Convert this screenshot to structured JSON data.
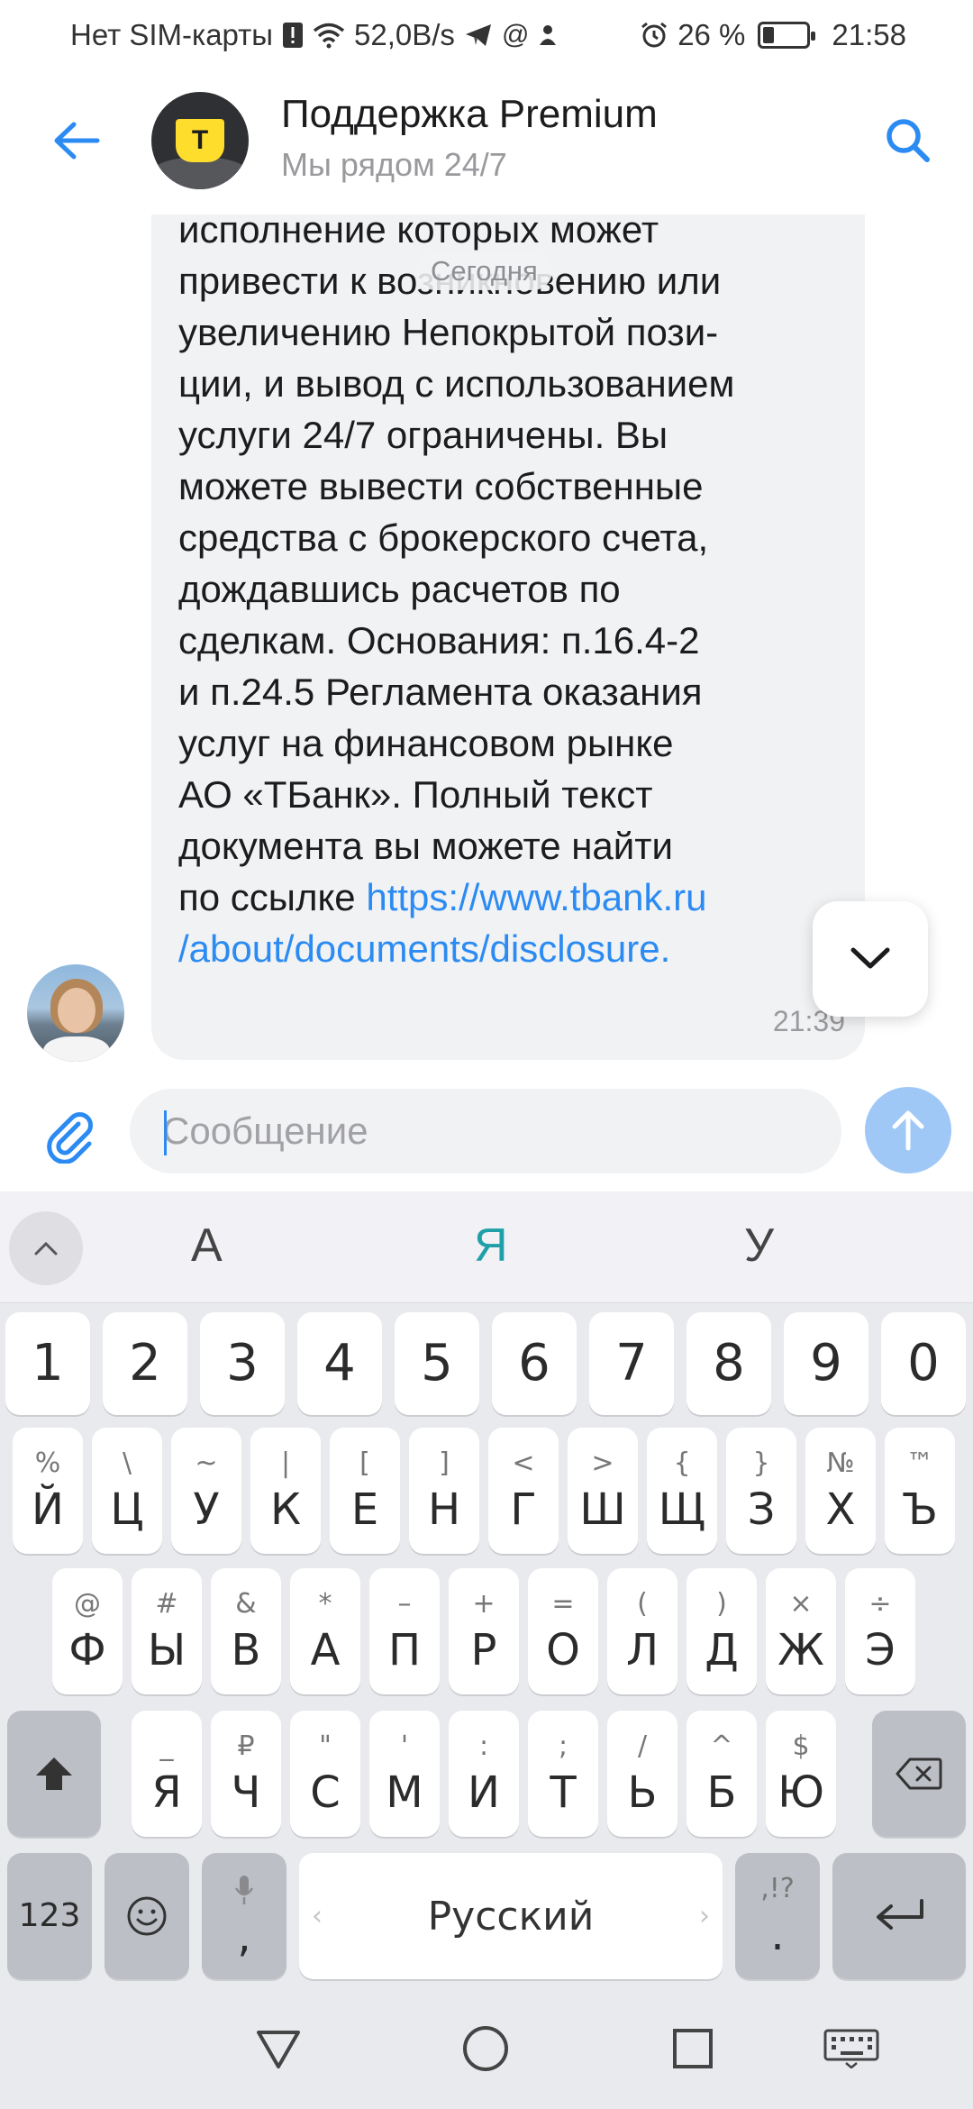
{
  "status_bar": {
    "carrier": "Нет SIM-карты",
    "net_speed": "52,0B/s",
    "battery_percent": "26 %",
    "battery_level": 0.26,
    "time": "21:58"
  },
  "header": {
    "title": "Поддержка Premium",
    "subtitle": "Мы рядом 24/7",
    "avatar_letter": "T"
  },
  "chat": {
    "date_chip": "Сегодня",
    "message": {
      "lines": [
        "исполнение которых может",
        "привести к возникновению или",
        "увеличению Непокрытой пози-",
        "ции, и вывод с использованием",
        "услуги 24/7 ограничены. Вы",
        "можете вывести собственные",
        "средства с брокерского счета,",
        "дождавшись расчетов по",
        "сделкам. Основания: п.16.4-2",
        "и п.24.5 Регламента оказания",
        "услуг на финансовом рынке",
        "АО «ТБанк». Полный текст",
        "документа вы можете найти"
      ],
      "link_prefix": "по ссылке ",
      "link_part1": "https://www.tbank.ru",
      "link_part2": "/about/documents/disclosure.",
      "time": "21:39"
    }
  },
  "input": {
    "placeholder": "Сообщение"
  },
  "keyboard": {
    "suggestions": [
      "А",
      "Я",
      "У"
    ],
    "number_row": [
      "1",
      "2",
      "3",
      "4",
      "5",
      "6",
      "7",
      "8",
      "9",
      "0"
    ],
    "row1": [
      {
        "main": "Й",
        "sub": "%"
      },
      {
        "main": "Ц",
        "sub": "\\"
      },
      {
        "main": "У",
        "sub": "~"
      },
      {
        "main": "К",
        "sub": "|"
      },
      {
        "main": "Е",
        "sub": "["
      },
      {
        "main": "Н",
        "sub": "]"
      },
      {
        "main": "Г",
        "sub": "<"
      },
      {
        "main": "Ш",
        "sub": ">"
      },
      {
        "main": "Щ",
        "sub": "{"
      },
      {
        "main": "З",
        "sub": "}"
      },
      {
        "main": "Х",
        "sub": "№"
      },
      {
        "main": "Ъ",
        "sub": "™"
      }
    ],
    "row2": [
      {
        "main": "Ф",
        "sub": "@"
      },
      {
        "main": "Ы",
        "sub": "#"
      },
      {
        "main": "В",
        "sub": "&"
      },
      {
        "main": "А",
        "sub": "*"
      },
      {
        "main": "П",
        "sub": "–"
      },
      {
        "main": "Р",
        "sub": "+"
      },
      {
        "main": "О",
        "sub": "="
      },
      {
        "main": "Л",
        "sub": "("
      },
      {
        "main": "Д",
        "sub": ")"
      },
      {
        "main": "Ж",
        "sub": "×"
      },
      {
        "main": "Э",
        "sub": "÷"
      }
    ],
    "row3": [
      {
        "main": "Я",
        "sub": "_"
      },
      {
        "main": "Ч",
        "sub": "₽"
      },
      {
        "main": "С",
        "sub": "\""
      },
      {
        "main": "М",
        "sub": "'"
      },
      {
        "main": "И",
        "sub": ":"
      },
      {
        "main": "Т",
        "sub": ";"
      },
      {
        "main": "Ь",
        "sub": "/"
      },
      {
        "main": "Б",
        "sub": "^"
      },
      {
        "main": "Ю",
        "sub": "$"
      }
    ],
    "bottom": {
      "numbers_label": "123",
      "comma": ",",
      "space_label": "Русский",
      "period": ".",
      "period_sub": ",!?"
    }
  },
  "icons": {
    "back": "arrow-left-icon",
    "search": "search-icon",
    "attach": "paperclip-icon",
    "send": "arrow-up-icon",
    "scroll_down": "chevron-down-icon"
  },
  "colors": {
    "accent": "#2b8bf2",
    "send_button": "#9fc8f7",
    "bubble": "#f1f2f4",
    "brand_yellow": "#ffdd2d",
    "suggestion_active": "#1fa0a8"
  }
}
